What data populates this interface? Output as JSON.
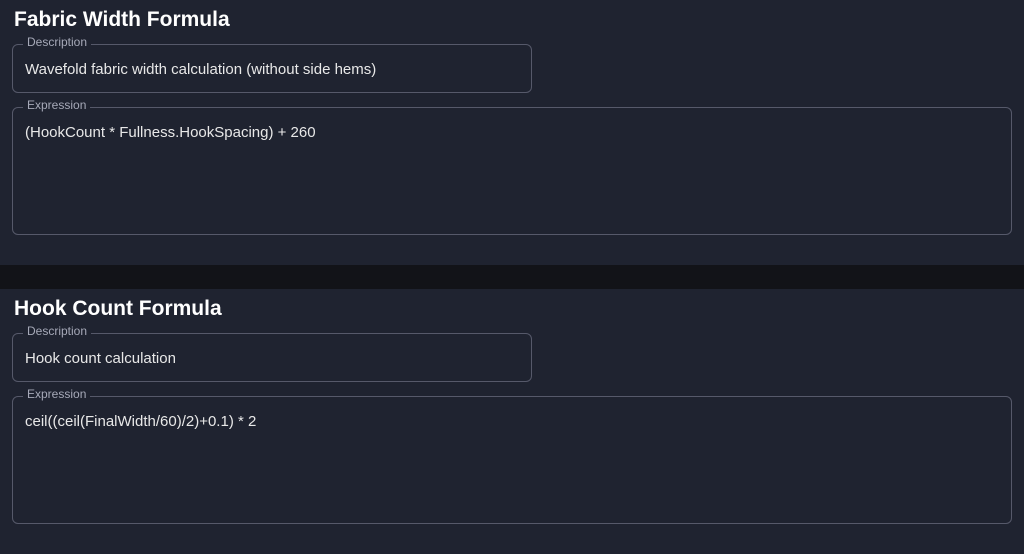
{
  "formulas": [
    {
      "title": "Fabric Width Formula",
      "descriptionLabel": "Description",
      "description": "Wavefold fabric width calculation (without side hems)",
      "expressionLabel": "Expression",
      "expression": "(HookCount * Fullness.HookSpacing) + 260"
    },
    {
      "title": "Hook Count Formula",
      "descriptionLabel": "Description",
      "description": "Hook count calculation",
      "expressionLabel": "Expression",
      "expression": "ceil((ceil(FinalWidth/60)/2)+0.1) * 2"
    }
  ]
}
